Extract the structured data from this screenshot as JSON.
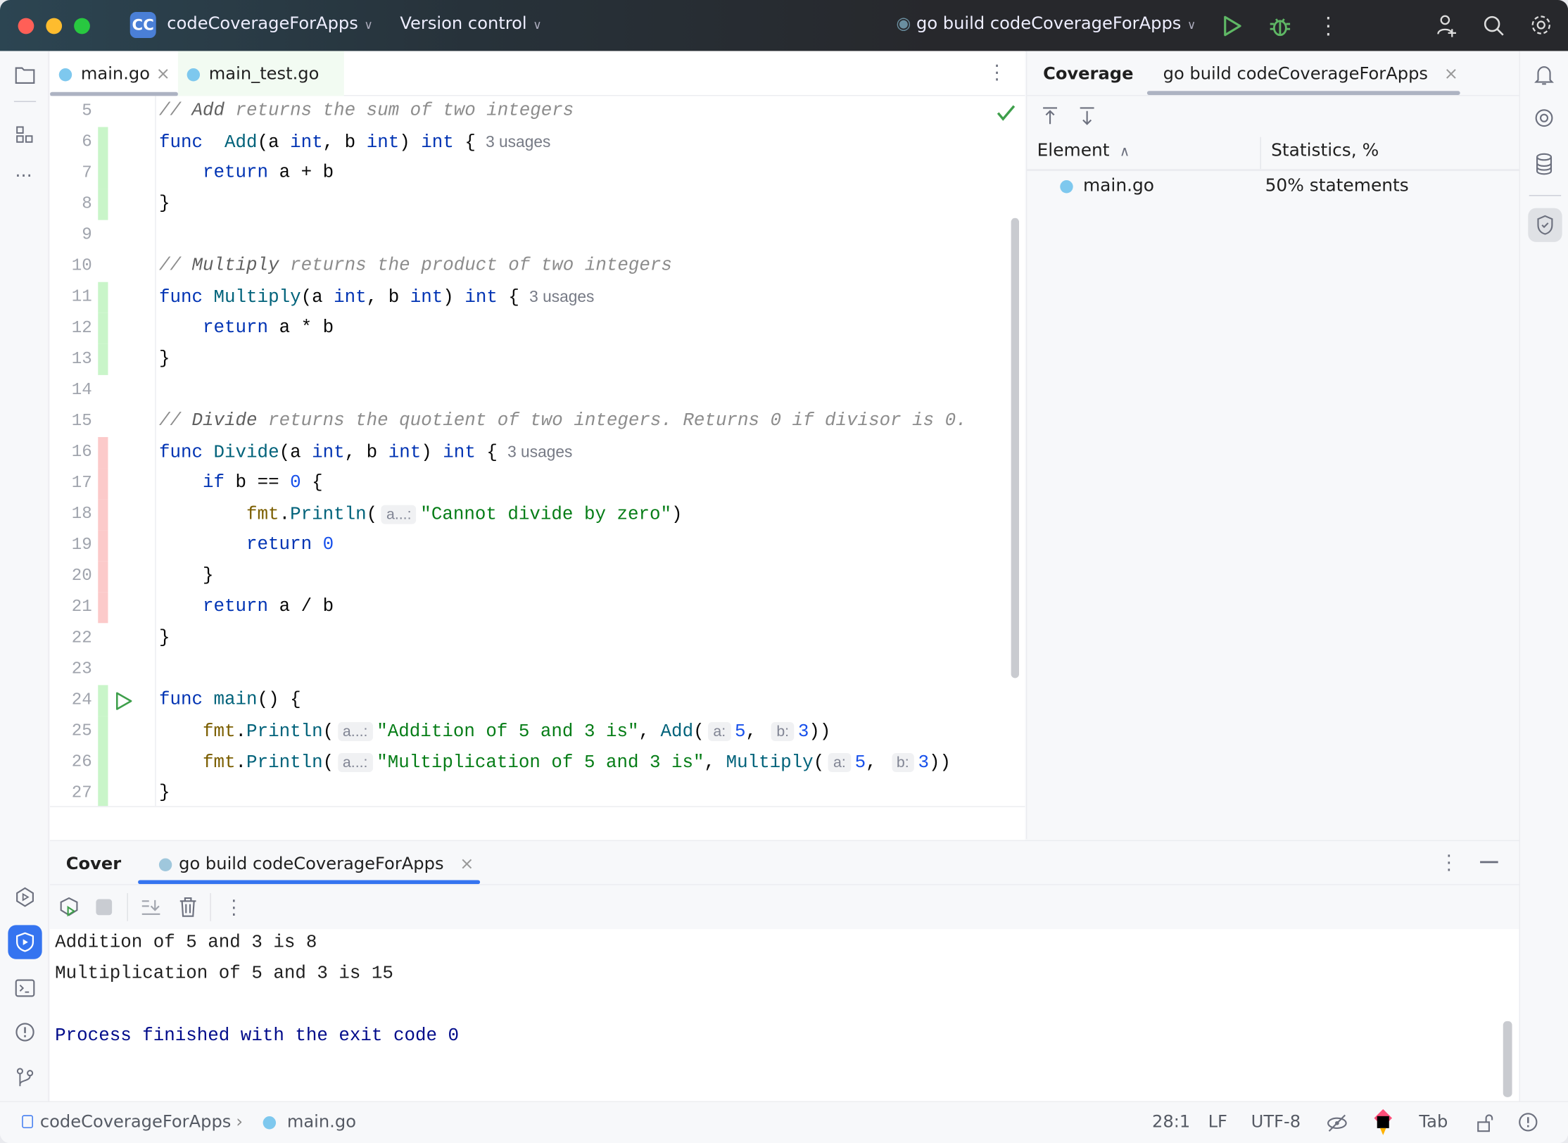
{
  "titlebar": {
    "project_badge": "CC",
    "project": "codeCoverageForApps",
    "vcs": "Version control",
    "run_config": "go build codeCoverageForApps",
    "colors": {
      "close": "#ff5f57",
      "minimize": "#febc2e",
      "maximize": "#28c840",
      "badge": "#4a7fd6",
      "run": "#5fb865"
    }
  },
  "tabs": [
    {
      "label": "main.go",
      "active": true
    },
    {
      "label": "main_test.go",
      "active": false
    }
  ],
  "editor": {
    "lines": [
      {
        "n": "5",
        "cov": "",
        "tokens": [
          [
            "cm",
            "// "
          ],
          [
            "cmb",
            "Add"
          ],
          [
            "cm",
            " returns the sum of two integers"
          ]
        ]
      },
      {
        "n": "6",
        "cov": "covered",
        "tokens": [
          [
            "kw",
            "func"
          ],
          [
            "",
            "  "
          ],
          [
            "fn",
            "Add"
          ],
          [
            "",
            "(a "
          ],
          [
            "kw",
            "int"
          ],
          [
            "",
            ", b "
          ],
          [
            "kw",
            "int"
          ],
          [
            "",
            ") "
          ],
          [
            "kw",
            "int"
          ],
          [
            "",
            " {"
          ],
          [
            "usage",
            "3 usages"
          ]
        ]
      },
      {
        "n": "7",
        "cov": "covered",
        "tokens": [
          [
            "",
            "    "
          ],
          [
            "kw",
            "return"
          ],
          [
            "",
            " a + b"
          ]
        ]
      },
      {
        "n": "8",
        "cov": "covered",
        "tokens": [
          [
            "",
            "}"
          ]
        ]
      },
      {
        "n": "9",
        "cov": "",
        "tokens": []
      },
      {
        "n": "10",
        "cov": "",
        "tokens": [
          [
            "cm",
            "// "
          ],
          [
            "cmb",
            "Multiply"
          ],
          [
            "cm",
            " returns the product of two integers"
          ]
        ]
      },
      {
        "n": "11",
        "cov": "covered",
        "tokens": [
          [
            "kw",
            "func"
          ],
          [
            "",
            " "
          ],
          [
            "fn",
            "Multiply"
          ],
          [
            "",
            "(a "
          ],
          [
            "kw",
            "int"
          ],
          [
            "",
            ", b "
          ],
          [
            "kw",
            "int"
          ],
          [
            "",
            ") "
          ],
          [
            "kw",
            "int"
          ],
          [
            "",
            " {"
          ],
          [
            "usage",
            "3 usages"
          ]
        ]
      },
      {
        "n": "12",
        "cov": "covered",
        "tokens": [
          [
            "",
            "    "
          ],
          [
            "kw",
            "return"
          ],
          [
            "",
            " a * b"
          ]
        ]
      },
      {
        "n": "13",
        "cov": "covered",
        "tokens": [
          [
            "",
            "}"
          ]
        ]
      },
      {
        "n": "14",
        "cov": "",
        "tokens": []
      },
      {
        "n": "15",
        "cov": "",
        "tokens": [
          [
            "cm",
            "// "
          ],
          [
            "cmb",
            "Divide"
          ],
          [
            "cm",
            " returns the quotient of two integers. Returns 0 if divisor is 0."
          ]
        ]
      },
      {
        "n": "16",
        "cov": "uncovered",
        "tokens": [
          [
            "kw",
            "func"
          ],
          [
            "",
            " "
          ],
          [
            "fn",
            "Divide"
          ],
          [
            "",
            "(a "
          ],
          [
            "kw",
            "int"
          ],
          [
            "",
            ", b "
          ],
          [
            "kw",
            "int"
          ],
          [
            "",
            ") "
          ],
          [
            "kw",
            "int"
          ],
          [
            "",
            " {"
          ],
          [
            "usage",
            "3 usages"
          ]
        ]
      },
      {
        "n": "17",
        "cov": "uncovered",
        "tokens": [
          [
            "",
            "    "
          ],
          [
            "kw",
            "if"
          ],
          [
            "",
            " b == "
          ],
          [
            "num",
            "0"
          ],
          [
            "",
            " {"
          ]
        ]
      },
      {
        "n": "18",
        "cov": "uncovered",
        "tokens": [
          [
            "",
            "        "
          ],
          [
            "pkg",
            "fmt"
          ],
          [
            "",
            "."
          ],
          [
            "fn",
            "Println"
          ],
          [
            "",
            "("
          ],
          [
            "hint",
            "a...:"
          ],
          [
            "str",
            "\"Cannot divide by zero\""
          ],
          [
            "",
            ")"
          ]
        ]
      },
      {
        "n": "19",
        "cov": "uncovered",
        "tokens": [
          [
            "",
            "        "
          ],
          [
            "kw",
            "return"
          ],
          [
            "",
            " "
          ],
          [
            "num",
            "0"
          ]
        ]
      },
      {
        "n": "20",
        "cov": "uncovered",
        "tokens": [
          [
            "",
            "    }"
          ]
        ]
      },
      {
        "n": "21",
        "cov": "uncovered",
        "tokens": [
          [
            "",
            "    "
          ],
          [
            "kw",
            "return"
          ],
          [
            "",
            " a / b"
          ]
        ]
      },
      {
        "n": "22",
        "cov": "",
        "tokens": [
          [
            "",
            "}"
          ]
        ]
      },
      {
        "n": "23",
        "cov": "",
        "tokens": []
      },
      {
        "n": "24",
        "cov": "covered",
        "run": true,
        "tokens": [
          [
            "kw",
            "func"
          ],
          [
            "",
            " "
          ],
          [
            "fn",
            "main"
          ],
          [
            "",
            "() {"
          ]
        ]
      },
      {
        "n": "25",
        "cov": "covered",
        "tokens": [
          [
            "",
            "    "
          ],
          [
            "pkg",
            "fmt"
          ],
          [
            "",
            "."
          ],
          [
            "fn",
            "Println"
          ],
          [
            "",
            "("
          ],
          [
            "hint",
            "a...:"
          ],
          [
            "str",
            "\"Addition of 5 and 3 is\""
          ],
          [
            "",
            ", "
          ],
          [
            "fn",
            "Add"
          ],
          [
            "",
            "("
          ],
          [
            "hint",
            "a:"
          ],
          [
            "num",
            "5"
          ],
          [
            "",
            ", "
          ],
          [
            "hint",
            "b:"
          ],
          [
            "num",
            "3"
          ],
          [
            "",
            "))"
          ]
        ]
      },
      {
        "n": "26",
        "cov": "covered",
        "tokens": [
          [
            "",
            "    "
          ],
          [
            "pkg",
            "fmt"
          ],
          [
            "",
            "."
          ],
          [
            "fn",
            "Println"
          ],
          [
            "",
            "("
          ],
          [
            "hint",
            "a...:"
          ],
          [
            "str",
            "\"Multiplication of 5 and 3 is\""
          ],
          [
            "",
            ", "
          ],
          [
            "fn",
            "Multiply"
          ],
          [
            "",
            "("
          ],
          [
            "hint",
            "a:"
          ],
          [
            "num",
            "5"
          ],
          [
            "",
            ", "
          ],
          [
            "hint",
            "b:"
          ],
          [
            "num",
            "3"
          ],
          [
            "",
            "))"
          ]
        ]
      },
      {
        "n": "27",
        "cov": "covered",
        "tokens": [
          [
            "",
            "}"
          ]
        ]
      }
    ],
    "colors": {
      "covered": "#c9f5c9",
      "uncovered": "#fccaca"
    }
  },
  "coverage_panel": {
    "title": "Coverage",
    "tab": "go build codeCoverageForApps",
    "col_element": "Element",
    "col_stats": "Statistics, %",
    "rows": [
      {
        "element": "main.go",
        "stats": "50% statements"
      }
    ]
  },
  "bottom": {
    "title": "Cover",
    "tab": "go build codeCoverageForApps",
    "console": [
      {
        "text": "Addition of 5 and 3 is 8",
        "type": "out"
      },
      {
        "text": "Multiplication of 5 and 3 is 15",
        "type": "out"
      },
      {
        "text": "",
        "type": "out"
      },
      {
        "text": "Process finished with the exit code 0",
        "type": "system"
      }
    ]
  },
  "status": {
    "project": "codeCoverageForApps",
    "file": "main.go",
    "position": "28:1",
    "line_sep": "LF",
    "encoding": "UTF-8",
    "indent": "Tab"
  }
}
